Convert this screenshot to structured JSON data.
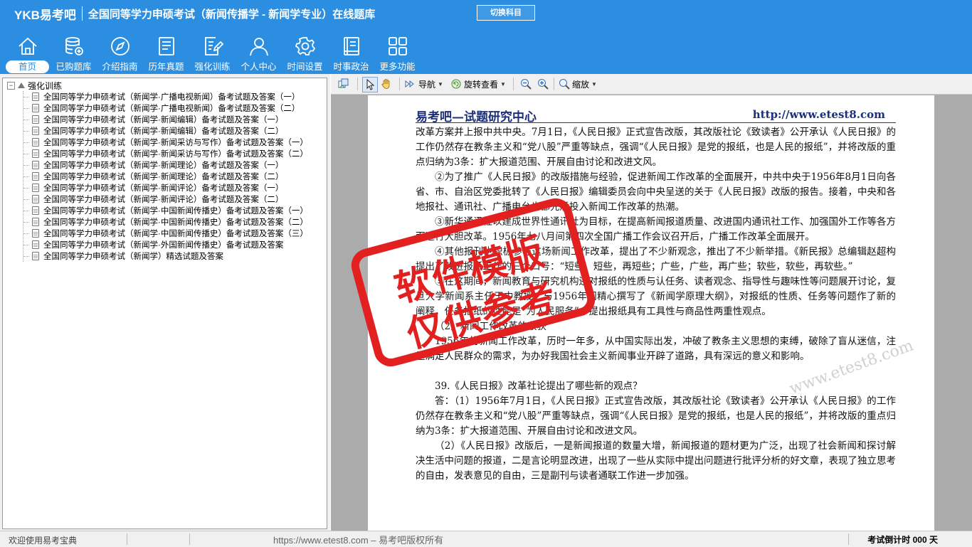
{
  "header": {
    "logo": "YKB易考吧",
    "title": "全国同等学力申硕考试（新闻传播学 - 新闻学专业）在线题库",
    "switch_button": "切换科目",
    "nav": [
      {
        "label": "首页",
        "icon": "home-icon",
        "active": true
      },
      {
        "label": "已购题库",
        "icon": "database-icon",
        "active": false
      },
      {
        "label": "介绍指南",
        "icon": "compass-icon",
        "active": false
      },
      {
        "label": "历年真题",
        "icon": "list-document-icon",
        "active": false
      },
      {
        "label": "强化训练",
        "icon": "edit-document-icon",
        "active": false
      },
      {
        "label": "个人中心",
        "icon": "user-icon",
        "active": false
      },
      {
        "label": "时间设置",
        "icon": "gear-icon",
        "active": false
      },
      {
        "label": "时事政治",
        "icon": "notebook-icon",
        "active": false
      },
      {
        "label": "更多功能",
        "icon": "grid-icon",
        "active": false
      }
    ]
  },
  "tree": {
    "root": "强化训练",
    "items": [
      "全国同等学力申硕考试（新闻学·广播电视新闻）备考试题及答案（一）",
      "全国同等学力申硕考试（新闻学·广播电视新闻）备考试题及答案（二）",
      "全国同等学力申硕考试（新闻学·新闻编辑）备考试题及答案（一）",
      "全国同等学力申硕考试（新闻学·新闻编辑）备考试题及答案（二）",
      "全国同等学力申硕考试（新闻学·新闻采访与写作）备考试题及答案（一）",
      "全国同等学力申硕考试（新闻学·新闻采访与写作）备考试题及答案（二）",
      "全国同等学力申硕考试（新闻学·新闻理论）备考试题及答案（一）",
      "全国同等学力申硕考试（新闻学·新闻理论）备考试题及答案（二）",
      "全国同等学力申硕考试（新闻学·新闻评论）备考试题及答案（一）",
      "全国同等学力申硕考试（新闻学·新闻评论）备考试题及答案（二）",
      "全国同等学力申硕考试（新闻学·中国新闻传播史）备考试题及答案（一）",
      "全国同等学力申硕考试（新闻学·中国新闻传播史）备考试题及答案（二）",
      "全国同等学力申硕考试（新闻学·中国新闻传播史）备考试题及答案（三）",
      "全国同等学力申硕考试（新闻学·外国新闻传播史）备考试题及答案",
      "全国同等学力申硕考试（新闻学）精选试题及答案"
    ]
  },
  "toolbar": {
    "navigate": "导航",
    "rotate": "旋转查看",
    "zoom": "缩放"
  },
  "page": {
    "header_left": "易考吧—试题研究中心",
    "header_right": "http://www.etest8.com",
    "paragraphs": [
      {
        "text": "改革方案并上报中共中央。7月1日，《人民日报》正式宣告改版，其改版社论《致读者》公开承认《人民日报》的工作仍然存在教条主义和“党八股”严重等缺点，强调“《人民日报》是党的报纸，也是人民的报纸”，并将改版的重点归纳为3条：扩大报道范围、开展自由讨论和改进文风。",
        "indent": false
      },
      {
        "text": "②为了推广《人民日报》的改版措施与经验，促进新闻工作改革的全面展开，中共中央于1956年8月1日向各省、市、自治区党委批转了《人民日报》编辑委员会向中央呈送的关于《人民日报》改版的报告。接着，中央和各地报社、通讯社、广播电台也都先后投入新闻工作改革的热潮。",
        "indent": true
      },
      {
        "text": "③新华通讯社以建成世界性通讯社为目标，在提高新闻报道质量、改进国内通讯社工作、加强国外工作等各方面进行大胆改革。1956年七八月间第四次全国广播工作会议召开后，广播工作改革全面展开。",
        "indent": true
      },
      {
        "text": "④其他报刊也积极参与这场新闻工作改革，提出了不少新观念，推出了不少新举措。《新民报》总编辑赵超构提出了改进报纸工作的三个口号：“短些，短些，再短些；广些，广些，再广些；软些，软些，再软些。”",
        "indent": true
      },
      {
        "text": "⑤在这期间，新闻教育与研究机构还对报纸的性质与认任务、读者观念、指导性与趣味性等问题展开讨论，复旦大学新闻系主任王中教授，与1956年间精心撰写了《新闻学原理大纲》，对报纸的性质、任务等问题作了新的阐释，任务报纸的性能是“为人民服务”，提出报纸具有工具性与商品性两重性观点。",
        "indent": true
      },
      {
        "text": "（2）新闻工作改革的收获",
        "indent": true
      },
      {
        "text": "1956年的新闻工作改革，历时一年多，从中国实际出发，冲破了教条主义思想的束缚，破除了盲从迷信，注重满足人民群众的需求，为办好我国社会主义新闻事业开辟了道路，具有深远的意义和影响。",
        "indent": true
      },
      {
        "text": "",
        "indent": false
      },
      {
        "text": "39.《人民日报》改革社论提出了哪些新的观点？",
        "indent": true
      },
      {
        "text": "答：（1）1956年7月1日，《人民日报》正式宣告改版，其改版社论《致读者》公开承认《人民日报》的工作仍然存在教条主义和“党八股”严重等缺点，强调“《人民日报》是党的报纸，也是人民的报纸”，并将改版的重点归纳为3条：扩大报道范围、开展自由讨论和改进文风。",
        "indent": true
      },
      {
        "text": "（2）《人民日报》改版后，一是新闻报道的数量大增，新闻报道的题材更为广泛，出现了社会新闻和探讨解决生活中问题的报道，二是言论明显改进，出现了一些从实际中提出问题进行批评分析的好文章，表现了独立思考的自由，发表意见的自由，三是副刊与读者通联工作进一步加强。",
        "indent": true
      }
    ],
    "stamp_line1": "软件模版",
    "stamp_line2": "仅供参考",
    "diagonal_watermark": "www.etest8.com"
  },
  "status": {
    "left": "欢迎使用易考宝典",
    "center": "https://www.etest8.com – 易考吧版权所有",
    "right": "考试倒计时 000 天"
  },
  "colors": {
    "header_bg": "#2b8ee0",
    "stamp": "#e32020",
    "page_heading": "#1c2f7a"
  }
}
